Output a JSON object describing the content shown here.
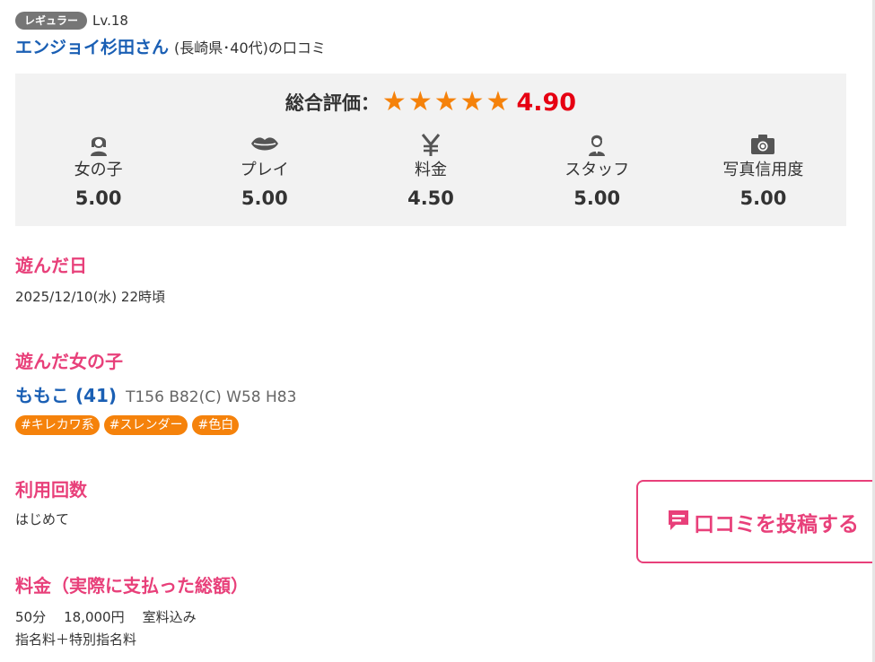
{
  "reviewer": {
    "badge": "レギュラー",
    "level": "Lv.18",
    "name": "エンジョイ杉田さん",
    "meta": "(長崎県･40代)の口コミ"
  },
  "rating": {
    "overall_label": "総合評価：",
    "overall_score": "4.90",
    "stars": 5,
    "star_color": "#f5820b",
    "categories": [
      {
        "icon": "woman-icon",
        "label": "女の子",
        "score": "5.00"
      },
      {
        "icon": "lips-icon",
        "label": "プレイ",
        "score": "5.00"
      },
      {
        "icon": "yen-icon",
        "label": "料金",
        "score": "4.50"
      },
      {
        "icon": "staff-icon",
        "label": "スタッフ",
        "score": "5.00"
      },
      {
        "icon": "camera-icon",
        "label": "写真信用度",
        "score": "5.00"
      }
    ]
  },
  "visit_date": {
    "title": "遊んだ日",
    "value": "2025/12/10(水) 22時頃"
  },
  "girl": {
    "title": "遊んだ女の子",
    "name": "ももこ (41)",
    "specs": "T156 B82(C) W58 H83",
    "tags": [
      "#キレカワ系",
      "#スレンダー",
      "#色白"
    ]
  },
  "usage_count": {
    "title": "利用回数",
    "value": "はじめて"
  },
  "price": {
    "title": "料金（実際に支払った総額）",
    "duration": "50分",
    "amount": "18,000円",
    "room": "室料込み",
    "note": "指名料＋特別指名料"
  },
  "post_button": {
    "icon": "comment-icon",
    "label": "口コミを投稿する"
  },
  "colors": {
    "accent_pink": "#e8407a",
    "link_blue": "#1a5fb4",
    "orange": "#f5820b",
    "score_red": "#e60012",
    "badge_gray": "#767676"
  }
}
